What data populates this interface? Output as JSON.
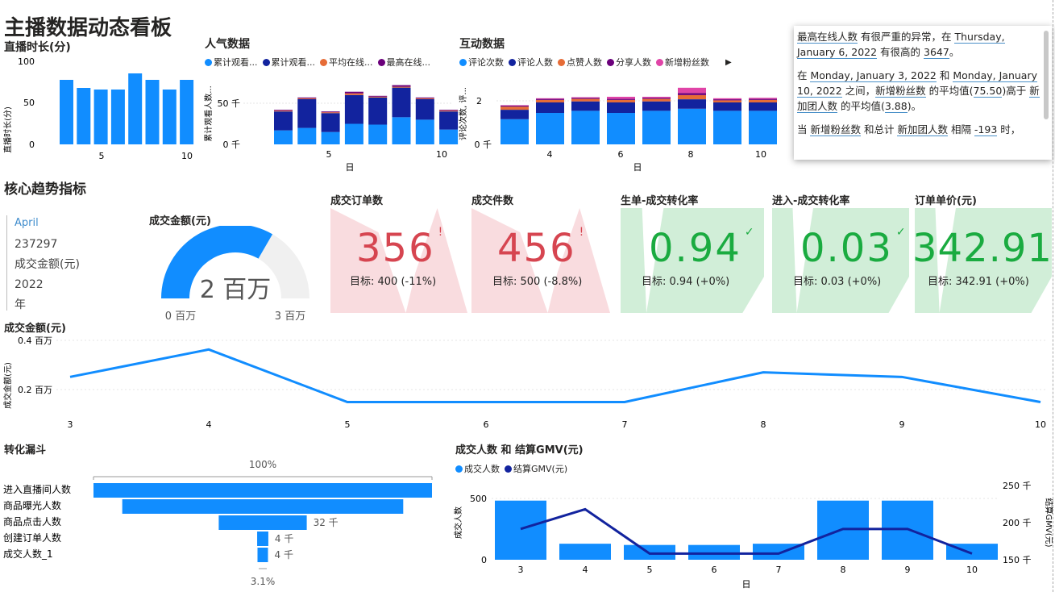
{
  "page": {
    "title": "主播数据动态看板"
  },
  "colors": {
    "blue": "#118dff",
    "navy": "#12239e",
    "orange": "#e66c37",
    "purple": "#6b007b",
    "pink": "#e044a7",
    "red": "#d64550",
    "green": "#1aab40",
    "grey": "#f0f0f0"
  },
  "live_duration": {
    "title": "直播时长(分)",
    "ylabel": "直播时长(分)",
    "y_ticks": [
      "100",
      "50",
      "0"
    ],
    "x_ticks": [
      "5",
      "10"
    ]
  },
  "popularity": {
    "title": "人气数据",
    "ylabel": "累计观看人数...",
    "xlabel": "日",
    "legend": [
      "累计观看...",
      "累计观看...",
      "平均在线...",
      "最高在线..."
    ],
    "y_ticks": [
      "50 千",
      "0 千"
    ],
    "x_ticks": [
      "5",
      "10"
    ]
  },
  "interaction": {
    "title": "互动数据",
    "ylabel": "评论次数, 评...",
    "xlabel": "日",
    "legend": [
      "评论次数",
      "评论人数",
      "点赞人数",
      "分享人数",
      "新增粉丝数"
    ],
    "y_ticks": [
      "2",
      "0 千"
    ],
    "x_ticks": [
      "4",
      "6",
      "8",
      "10"
    ]
  },
  "tooltip": {
    "p1": {
      "a": "最高在线人数",
      "b": " 有很严重的异常，在 ",
      "c": "Thursday, January 6, 2022",
      "d": " 有很高的 ",
      "e": "3647",
      "f": "。"
    },
    "p2": {
      "a": "在 ",
      "b": "Monday, January 3, 2022",
      "c": " 和 ",
      "d": "Monday, January 10, 2022",
      "e": " 之间，",
      "f": "新增粉丝数",
      "g": " 的平均值(",
      "h": "75.50",
      "i": ")高于 ",
      "j": "新加团人数",
      "k": " 的平均值(",
      "l": "3.88",
      "m": ")。"
    },
    "p3": {
      "a": "当 ",
      "b": "新增粉丝数",
      "c": " 和总计 ",
      "d": "新加团人数",
      "e": " 相隔 ",
      "f": "-193",
      "g": " 时，"
    }
  },
  "core": {
    "title": "核心趋势指标"
  },
  "slicer": {
    "month": "April",
    "value": "237297",
    "value_label": "成交金额(元)",
    "year": "2022",
    "year_label": "年"
  },
  "gauge": {
    "title": "成交金额(元)",
    "value": "2 百万",
    "min": "0 百万",
    "max": "3 百万",
    "fraction": 0.667
  },
  "kpis": [
    {
      "title": "成交订单数",
      "value": "356",
      "mark": "!",
      "goal": "目标: 400 (-11%)",
      "status": "bad"
    },
    {
      "title": "成交件数",
      "value": "456",
      "mark": "!",
      "goal": "目标: 500 (-8.8%)",
      "status": "bad"
    },
    {
      "title": "生单-成交转化率",
      "value": "0.94",
      "mark": "✓",
      "goal": "目标: 0.94 (+0%)",
      "status": "good"
    },
    {
      "title": "进入-成交转化率",
      "value": "0.03",
      "mark": "✓",
      "goal": "目标: 0.03 (+0%)",
      "status": "good"
    },
    {
      "title": "订单单价(元)",
      "value": "342.91",
      "mark": "✓",
      "goal": "目标: 342.91 (+0%)",
      "status": "good"
    }
  ],
  "amount_line": {
    "title": "成交金额(元)",
    "ylabel": "成交金额(元)",
    "y_ticks": [
      "0.4 百万",
      "0.2 百万"
    ]
  },
  "funnel": {
    "title": "转化漏斗",
    "top_label": "100%",
    "bottom_label": "3.1%",
    "rows": [
      {
        "name": "进入直播间人数",
        "pct": 1.0,
        "label": ""
      },
      {
        "name": "商品曝光人数",
        "pct": 0.83,
        "label": ""
      },
      {
        "name": "商品点击人数",
        "pct": 0.26,
        "label": "32 千"
      },
      {
        "name": "创建订单人数",
        "pct": 0.033,
        "label": "4 千"
      },
      {
        "name": "成交人数_1",
        "pct": 0.031,
        "label": "4 千"
      }
    ]
  },
  "combo": {
    "title": "成交人数 和 结算GMV(元)",
    "legend": [
      "成交人数",
      "结算GMV(元)"
    ],
    "ylabel_left": "成交人数",
    "ylabel_right": "结算GMV(元)",
    "xlabel": "日",
    "y_left_ticks": [
      "500",
      "0"
    ],
    "y_right_ticks": [
      "250 千",
      "200 千",
      "150 千"
    ]
  },
  "chart_data": [
    {
      "type": "bar",
      "title": "直播时长(分)",
      "ylabel": "直播时长(分)",
      "x": [
        3,
        4,
        5,
        6,
        7,
        8,
        9,
        10
      ],
      "values": [
        80,
        70,
        68,
        68,
        88,
        80,
        68,
        80
      ],
      "ylim": [
        0,
        100
      ]
    },
    {
      "type": "bar",
      "title": "人气数据",
      "xlabel": "日",
      "ylabel": "累计观看人数...",
      "x": [
        3,
        4,
        5,
        6,
        7,
        8,
        9,
        10
      ],
      "series": [
        {
          "name": "累计观看...",
          "values": [
            17,
            20,
            15,
            25,
            24,
            33,
            30,
            18
          ]
        },
        {
          "name": "累计观看...",
          "values": [
            23,
            35,
            23,
            35,
            33,
            36,
            25,
            22
          ]
        },
        {
          "name": "平均在线...",
          "values": [
            1,
            1,
            1,
            2,
            1,
            1,
            1,
            1
          ]
        },
        {
          "name": "最高在线...",
          "values": [
            1,
            1,
            1,
            2,
            1,
            2,
            1,
            1
          ]
        }
      ],
      "ylim": [
        0,
        80
      ]
    },
    {
      "type": "bar",
      "title": "互动数据",
      "xlabel": "日",
      "ylabel": "评论次数, 评...",
      "x": [
        3,
        4,
        5,
        6,
        7,
        8,
        9,
        10
      ],
      "series": [
        {
          "name": "评论次数",
          "values": [
            1.2,
            1.5,
            1.6,
            1.5,
            1.6,
            1.7,
            1.6,
            1.6
          ]
        },
        {
          "name": "评论人数",
          "values": [
            0.45,
            0.5,
            0.45,
            0.5,
            0.45,
            0.45,
            0.4,
            0.4
          ]
        },
        {
          "name": "点赞人数",
          "values": [
            0.15,
            0.12,
            0.12,
            0.12,
            0.12,
            0.2,
            0.1,
            0.12
          ]
        },
        {
          "name": "分享人数",
          "values": [
            0.05,
            0.05,
            0.05,
            0.05,
            0.05,
            0.1,
            0.05,
            0.05
          ]
        },
        {
          "name": "新增粉丝数",
          "values": [
            0.02,
            0.03,
            0.03,
            0.1,
            0.05,
            0.25,
            0.05,
            0.05
          ]
        }
      ],
      "ylim": [
        0,
        3
      ]
    },
    {
      "type": "line",
      "title": "成交金额(元)",
      "ylabel": "成交金额(元)",
      "x": [
        3,
        4,
        5,
        6,
        7,
        8,
        9,
        10
      ],
      "values": [
        0.24,
        0.36,
        0.13,
        0.13,
        0.13,
        0.26,
        0.24,
        0.13
      ],
      "ylim": [
        0.1,
        0.4
      ],
      "unit": "百万"
    },
    {
      "type": "bar",
      "title": "成交人数 和 结算GMV(元)",
      "xlabel": "日",
      "x": [
        3,
        4,
        5,
        6,
        7,
        8,
        9,
        10
      ],
      "series": [
        {
          "name": "成交人数",
          "values": [
            480,
            130,
            120,
            120,
            130,
            480,
            480,
            130
          ]
        },
        {
          "name": "结算GMV(元)",
          "type": "line",
          "values": [
            200,
            232,
            160,
            160,
            160,
            200,
            200,
            160
          ]
        }
      ],
      "ylim_left": [
        0,
        550
      ],
      "ylim_right": [
        150,
        260
      ]
    }
  ]
}
